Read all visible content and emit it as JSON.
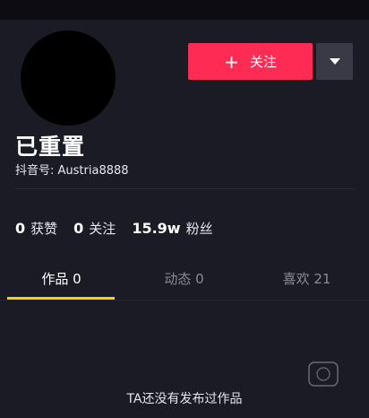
{
  "profile": {
    "nickname": "已重置",
    "douyin_id": "抖音号: Austria8888",
    "follow_label": "关注",
    "follow_icon": "plus-icon",
    "more_icon": "caret-down-icon"
  },
  "stats": [
    {
      "value": "0",
      "label": "获赞"
    },
    {
      "value": "0",
      "label": "关注"
    },
    {
      "value": "15.9w",
      "label": "粉丝"
    }
  ],
  "tabs": [
    {
      "label": "作品 0",
      "active": true
    },
    {
      "label": "动态 0",
      "active": false
    },
    {
      "label": "喜欢 21",
      "active": false
    }
  ],
  "empty_state": "TA还没有发布过作品",
  "colors": {
    "background": "#1a1b25",
    "follow_button": "#fe2c55",
    "more_button": "#393a45",
    "tab_underline": "#face15",
    "inactive_tab": "#8a8b96"
  }
}
